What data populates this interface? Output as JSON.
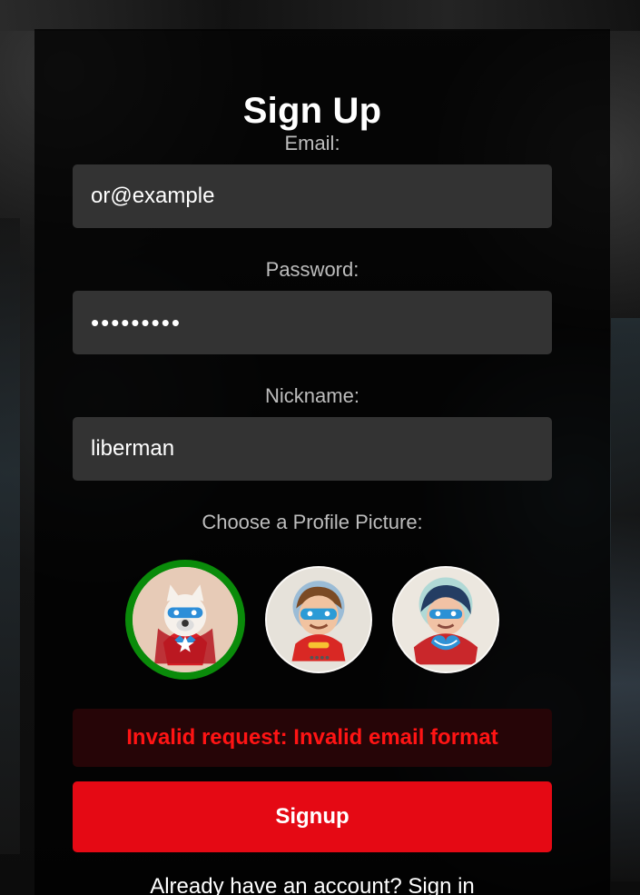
{
  "page": {
    "title": "Sign Up"
  },
  "form": {
    "email_label": "Email:",
    "email_value": "or@example",
    "password_label": "Password:",
    "password_value": "•••••••••",
    "nickname_label": "Nickname:",
    "nickname_value": "liberman",
    "profile_picture_label": "Choose a Profile Picture:"
  },
  "profile_pictures": [
    {
      "name": "dog-superhero-avatar",
      "selected": true
    },
    {
      "name": "boy-superhero-avatar",
      "selected": false
    },
    {
      "name": "girl-superhero-avatar",
      "selected": false
    }
  ],
  "messages": {
    "error": "Invalid request: Invalid email format"
  },
  "actions": {
    "submit_label": "Signup",
    "signin_link": "Already have an account? Sign in"
  },
  "colors": {
    "accent": "#e50914",
    "error": "#ff1414",
    "selected": "#0a8b0a",
    "field": "#333333"
  }
}
